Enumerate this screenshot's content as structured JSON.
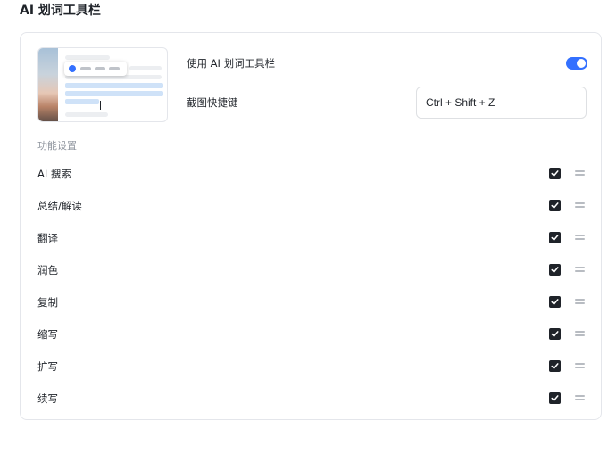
{
  "header": {
    "title": "AI 划词工具栏"
  },
  "settings": {
    "enable_label": "使用 AI 划词工具栏",
    "enable_on": true,
    "shortcut_label": "截图快捷键",
    "shortcut_value": "Ctrl + Shift + Z"
  },
  "features": {
    "group_title": "功能设置",
    "items": [
      {
        "label": "AI 搜索",
        "checked": true
      },
      {
        "label": "总结/解读",
        "checked": true
      },
      {
        "label": "翻译",
        "checked": true
      },
      {
        "label": "润色",
        "checked": true
      },
      {
        "label": "复制",
        "checked": true
      },
      {
        "label": "缩写",
        "checked": true
      },
      {
        "label": "扩写",
        "checked": true
      },
      {
        "label": "续写",
        "checked": true
      }
    ]
  },
  "colors": {
    "accent": "#3370ff",
    "checkbox": "#1f2329",
    "muted_text": "#8f959e"
  },
  "icons": [
    "check-icon",
    "drag-handle-icon"
  ]
}
